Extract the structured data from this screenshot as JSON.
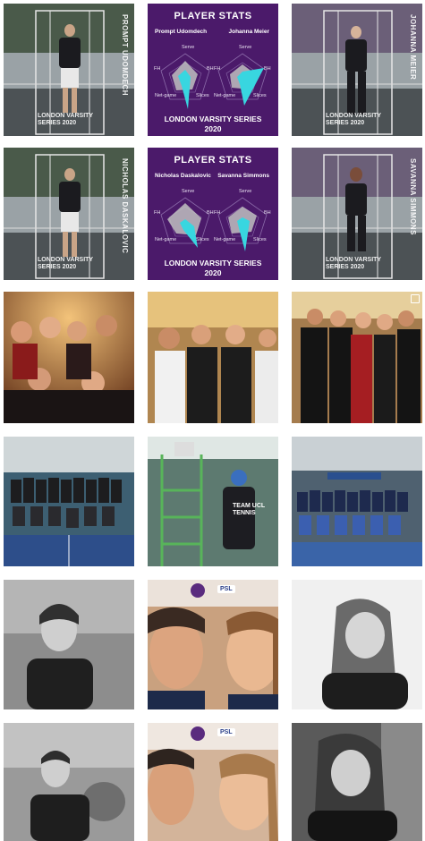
{
  "grid": {
    "posts": [
      {
        "id": "player-card-prompt",
        "court_label": "PROMPT UDOMDECH",
        "footer": [
          "LONDON VARSITY",
          "SERIES 2020"
        ]
      },
      {
        "id": "stats-card-1",
        "title": "PLAYER STATS",
        "players": [
          "Prompt Udomdech",
          "Johanna Meier"
        ],
        "axes": [
          "Serve",
          "FH",
          "BH",
          "Net-game",
          "Slices"
        ],
        "footer": [
          "LONDON VARSITY SERIES",
          "2020"
        ]
      },
      {
        "id": "player-card-johanna",
        "court_label": "JOHANNA MEIER",
        "footer": [
          "LONDON VARSITY",
          "SERIES 2020"
        ]
      },
      {
        "id": "player-card-nicholas",
        "court_label": "NICHOLAS DASKALOVIC",
        "footer": [
          "LONDON VARSITY",
          "SERIES 2020"
        ]
      },
      {
        "id": "stats-card-2",
        "title": "PLAYER STATS",
        "players": [
          "Nicholas Daskalovic",
          "Savanna Simmons"
        ],
        "axes": [
          "Serve",
          "FH",
          "BH",
          "Net-game",
          "Slices"
        ],
        "footer": [
          "LONDON VARSITY SERIES",
          "2020"
        ]
      },
      {
        "id": "player-card-savanna",
        "court_label": "SAVANNA SIMMONS",
        "footer": [
          "LONDON VARSITY",
          "SERIES 2020"
        ]
      },
      {
        "id": "gala-photo-1"
      },
      {
        "id": "gala-photo-2"
      },
      {
        "id": "gala-photo-3"
      },
      {
        "id": "team-photo-1"
      },
      {
        "id": "umpire-chair-photo",
        "shirt_text": [
          "TEAM UCL",
          "TENNIS"
        ]
      },
      {
        "id": "team-photo-2"
      },
      {
        "id": "portrait-bw-1"
      },
      {
        "id": "psl-promo-1",
        "badge": "PSL"
      },
      {
        "id": "portrait-bw-2"
      },
      {
        "id": "portrait-bw-3"
      },
      {
        "id": "psl-promo-2",
        "badge": "PSL"
      },
      {
        "id": "portrait-bw-4"
      }
    ]
  },
  "colors": {
    "stats_bg": "#4b1a6a",
    "radar_cyan": "#38d6e0",
    "radar_grey": "#bfbfbf",
    "court_grey": "#8f969c",
    "court_dark": "#3a3f43"
  },
  "icons": {
    "multi_post": "multi-image-icon"
  }
}
